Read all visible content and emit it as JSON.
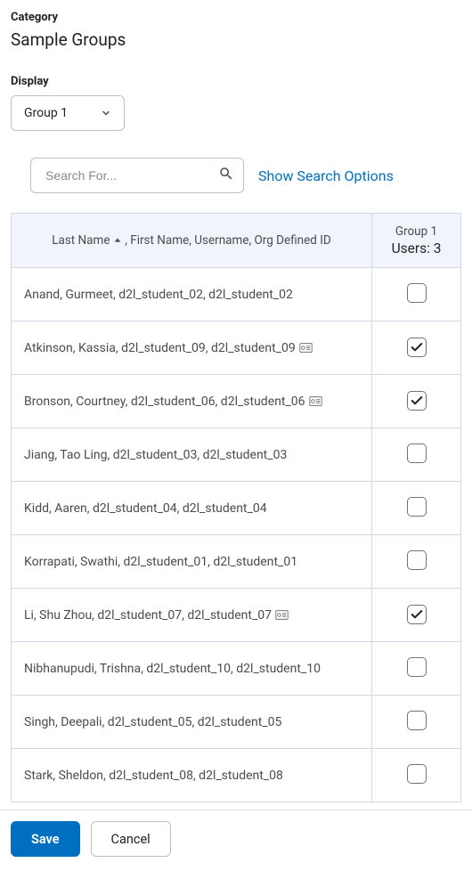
{
  "category": {
    "label": "Category",
    "value": "Sample Groups"
  },
  "display": {
    "label": "Display",
    "selected": "Group 1"
  },
  "search": {
    "placeholder": "Search For...",
    "show_options": "Show Search Options"
  },
  "table": {
    "header_main": "Last Name ",
    "header_main_rest": " , First Name, Username, Org Defined ID",
    "group_name": "Group 1",
    "group_users_label": "Users: 3"
  },
  "rows": [
    {
      "name": "Anand, Gurmeet, d2l_student_02, d2l_student_02",
      "alias": false,
      "checked": false
    },
    {
      "name": "Atkinson, Kassia, d2l_student_09, d2l_student_09",
      "alias": true,
      "checked": true
    },
    {
      "name": "Bronson, Courtney, d2l_student_06, d2l_student_06",
      "alias": true,
      "checked": true
    },
    {
      "name": "Jiang, Tao Ling, d2l_student_03, d2l_student_03",
      "alias": false,
      "checked": false
    },
    {
      "name": "Kidd, Aaren, d2l_student_04, d2l_student_04",
      "alias": false,
      "checked": false
    },
    {
      "name": "Korrapati, Swathi, d2l_student_01, d2l_student_01",
      "alias": false,
      "checked": false
    },
    {
      "name": "Li, Shu Zhou, d2l_student_07, d2l_student_07",
      "alias": true,
      "checked": true
    },
    {
      "name": "Nibhanupudi, Trishna, d2l_student_10, d2l_student_10",
      "alias": false,
      "checked": false
    },
    {
      "name": "Singh, Deepali, d2l_student_05, d2l_student_05",
      "alias": false,
      "checked": false
    },
    {
      "name": "Stark, Sheldon, d2l_student_08, d2l_student_08",
      "alias": false,
      "checked": false
    }
  ],
  "footer": {
    "save": "Save",
    "cancel": "Cancel"
  }
}
